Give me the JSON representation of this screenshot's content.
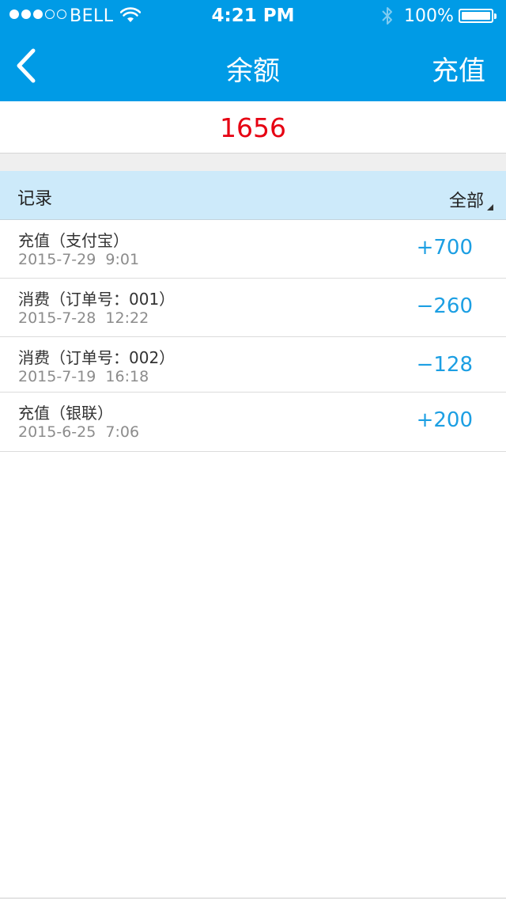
{
  "status_bar": {
    "signal_full": 3,
    "signal_total": 5,
    "carrier": "BELL",
    "time": "4:21 PM",
    "battery": "100%"
  },
  "nav": {
    "back_icon": "chevron-left-icon",
    "title": "余额",
    "action": "充值"
  },
  "balance": {
    "value": "1656",
    "color": "#e60012"
  },
  "records": {
    "title": "记录",
    "filter": "全部",
    "items": [
      {
        "desc": "充值（支付宝）",
        "date": "2015-7-29  9:01",
        "amount": "+700"
      },
      {
        "desc": "消费（订单号：001）",
        "date": "2015-7-28  12:22",
        "amount": "−260"
      },
      {
        "desc": "消费（订单号：002）",
        "date": "2015-7-19  16:18",
        "amount": "−128"
      },
      {
        "desc": "充值（银联）",
        "date": "2015-6-25  7:06",
        "amount": "+200"
      }
    ]
  },
  "colors": {
    "brand": "#009be6",
    "header_bg": "#cdeafa",
    "amount": "#1c9fe3"
  }
}
